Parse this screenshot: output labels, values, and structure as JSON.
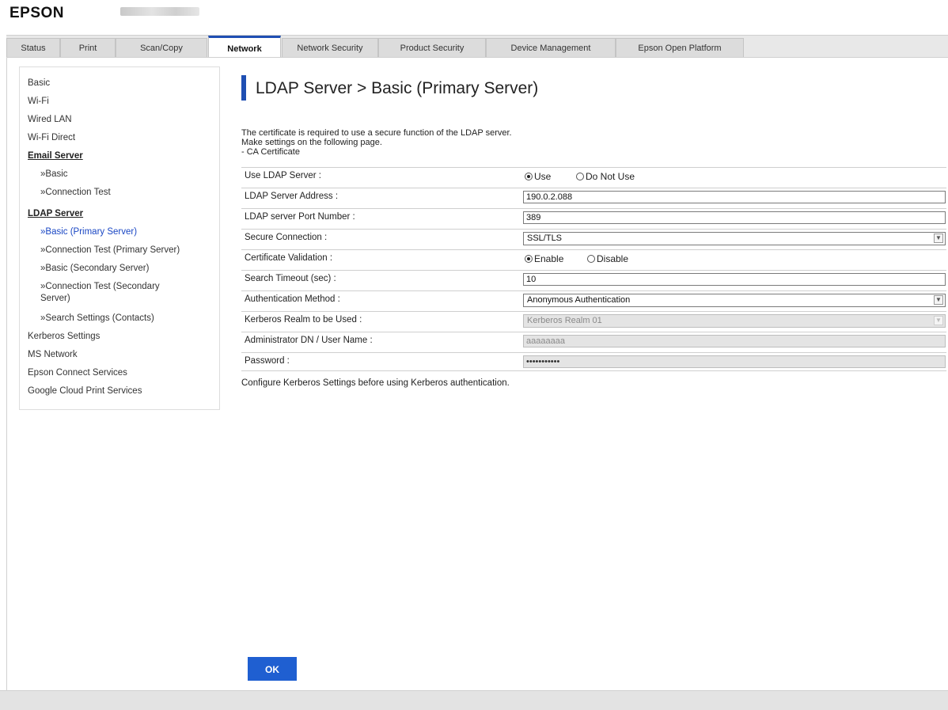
{
  "brand": {
    "logo": "EPSON"
  },
  "tabs": [
    {
      "label": "Status"
    },
    {
      "label": "Print"
    },
    {
      "label": "Scan/Copy"
    },
    {
      "label": "Network",
      "active": true
    },
    {
      "label": "Network Security"
    },
    {
      "label": "Product Security"
    },
    {
      "label": "Device Management"
    },
    {
      "label": "Epson Open Platform"
    }
  ],
  "sidebar": {
    "items": [
      {
        "label": "Basic"
      },
      {
        "label": "Wi-Fi"
      },
      {
        "label": "Wired LAN"
      },
      {
        "label": "Wi-Fi Direct"
      },
      {
        "label": "Email Server"
      },
      {
        "label": "»Basic"
      },
      {
        "label": "»Connection Test"
      },
      {
        "label": "LDAP Server"
      },
      {
        "label": "»Basic (Primary Server)"
      },
      {
        "label": "»Connection Test (Primary Server)"
      },
      {
        "label": "»Basic (Secondary Server)"
      },
      {
        "label": "»Connection Test (Secondary"
      },
      {
        "label": "Server)"
      },
      {
        "label": "»Search Settings (Contacts)"
      },
      {
        "label": "Kerberos Settings"
      },
      {
        "label": "MS Network"
      },
      {
        "label": "Epson Connect Services"
      },
      {
        "label": "Google Cloud Print Services"
      }
    ]
  },
  "main": {
    "title": "LDAP Server > Basic (Primary Server)",
    "notes": [
      "The certificate is required to use a secure function of the LDAP server.",
      "Make settings on the following page.",
      "- CA Certificate"
    ],
    "form": {
      "use_ldap": {
        "label": "Use LDAP Server :",
        "option_use": "Use",
        "option_not": "Do Not Use",
        "selected": "Use"
      },
      "server_address": {
        "label": "LDAP Server Address :",
        "value": "190.0.2.088"
      },
      "port": {
        "label": "LDAP server Port Number :",
        "value": "389"
      },
      "secure_connection": {
        "label": "Secure Connection :",
        "value": "SSL/TLS"
      },
      "cert_validation": {
        "label": "Certificate Validation :",
        "option_enable": "Enable",
        "option_disable": "Disable",
        "selected": "Enable"
      },
      "timeout": {
        "label": "Search Timeout (sec) :",
        "value": "10"
      },
      "auth_method": {
        "label": "Authentication Method :",
        "value": "Anonymous Authentication"
      },
      "kerberos_realm": {
        "label": "Kerberos Realm to be Used :",
        "value": "Kerberos Realm 01"
      },
      "admin_dn": {
        "label": "Administrator DN / User Name :",
        "value": "aaaaaaaa"
      },
      "password": {
        "label": "Password :",
        "value": "•••••••••••"
      }
    },
    "footnote": "Configure Kerberos Settings before using Kerberos authentication.",
    "ok_label": "OK"
  }
}
